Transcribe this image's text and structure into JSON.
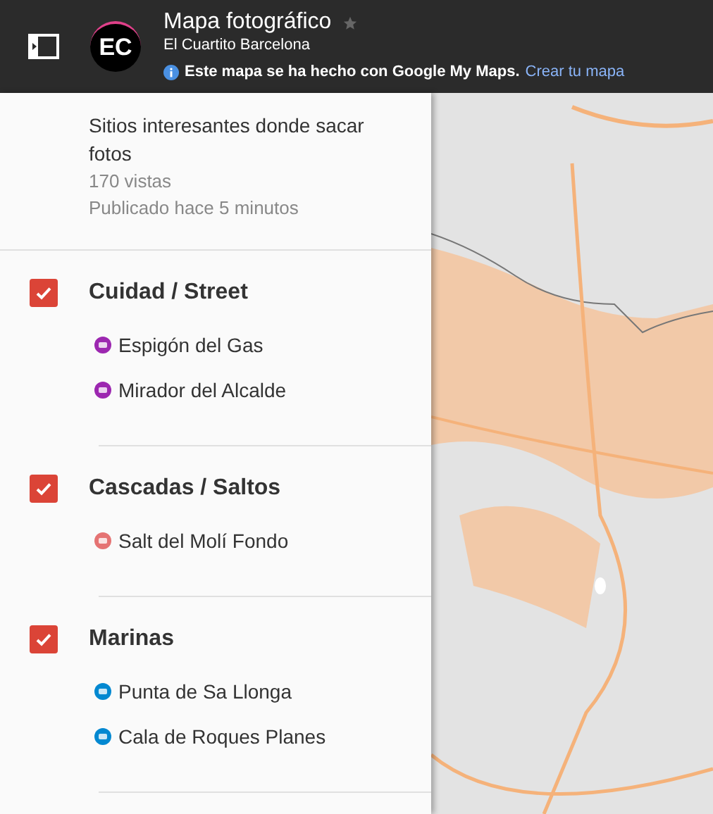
{
  "header": {
    "avatar": "EC",
    "title": "Mapa fotográfico",
    "subtitle": "El Cuartito Barcelona",
    "notice": "Este mapa se ha hecho con Google My Maps.",
    "notice_link": "Crear tu mapa"
  },
  "description": {
    "text": "Sitios interesantes donde sacar fotos",
    "views": "170 vistas",
    "published": "Publicado hace 5 minutos"
  },
  "layers": [
    {
      "title": "Cuidad / Street",
      "checked": true,
      "items": [
        {
          "label": "Espigón del Gas",
          "color": "#9c27b0"
        },
        {
          "label": "Mirador del Alcalde",
          "color": "#9c27b0"
        }
      ]
    },
    {
      "title": "Cascadas / Saltos",
      "checked": true,
      "items": [
        {
          "label": "Salt del Molí Fondo",
          "color": "#e57373"
        }
      ]
    },
    {
      "title": "Marinas",
      "checked": true,
      "items": [
        {
          "label": "Punta de Sa Llonga",
          "color": "#0288d1"
        },
        {
          "label": "Cala de Roques Planes",
          "color": "#0288d1"
        }
      ]
    }
  ]
}
